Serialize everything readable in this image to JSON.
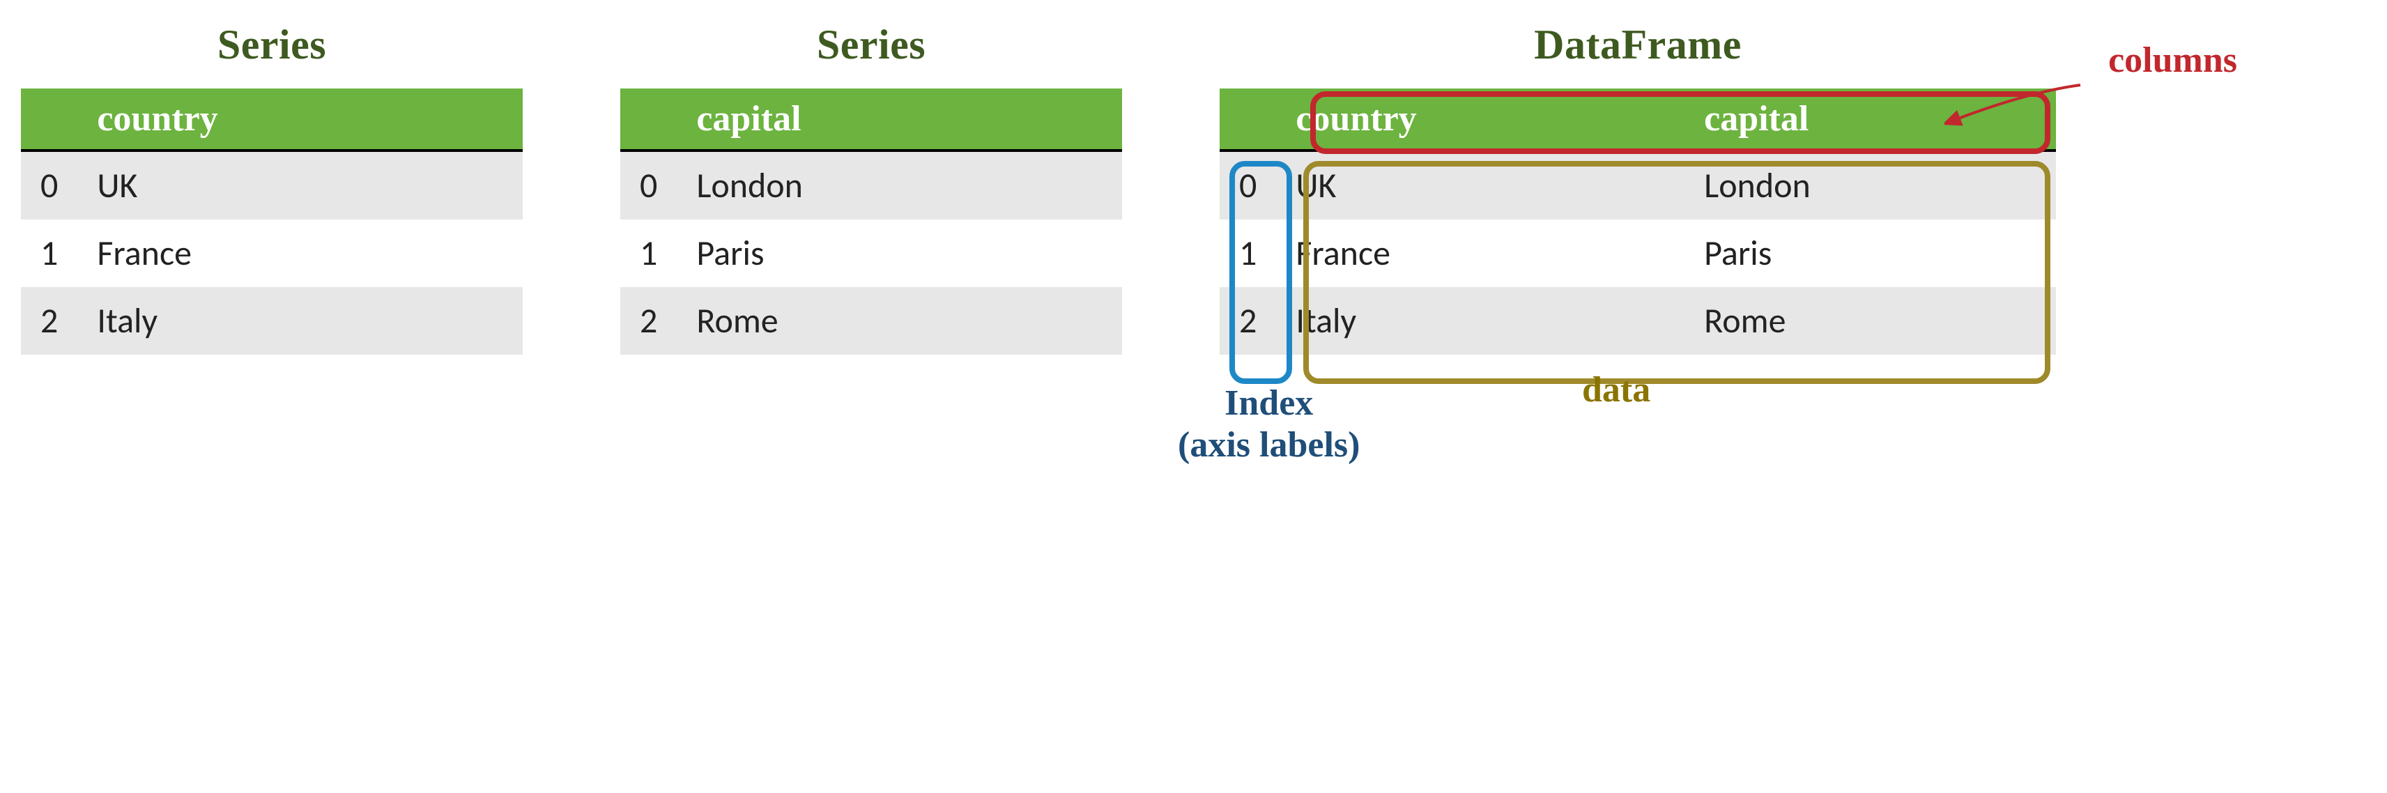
{
  "panels": {
    "series1": {
      "title": "Series",
      "header": "country",
      "rows": [
        {
          "idx": "0",
          "val": "UK"
        },
        {
          "idx": "1",
          "val": "France"
        },
        {
          "idx": "2",
          "val": "Italy"
        }
      ]
    },
    "series2": {
      "title": "Series",
      "header": "capital",
      "rows": [
        {
          "idx": "0",
          "val": "London"
        },
        {
          "idx": "1",
          "val": "Paris"
        },
        {
          "idx": "2",
          "val": "Rome"
        }
      ]
    },
    "dataframe": {
      "title": "DataFrame",
      "headers": [
        "country",
        "capital"
      ],
      "rows": [
        {
          "idx": "0",
          "c0": "UK",
          "c1": "London"
        },
        {
          "idx": "1",
          "c0": "France",
          "c1": "Paris"
        },
        {
          "idx": "2",
          "c0": "Italy",
          "c1": "Rome"
        }
      ]
    }
  },
  "annotations": {
    "columns": "columns",
    "index_line1": "Index",
    "index_line2": "(axis labels)",
    "data": "data"
  },
  "colors": {
    "headerGreen": "#6cb33f",
    "titleOlive": "#3e5a20",
    "red": "#c1272d",
    "blue": "#1e88c7",
    "blueText": "#1f4e79",
    "olive": "#9e8a2a",
    "oliveText": "#8a7400"
  }
}
